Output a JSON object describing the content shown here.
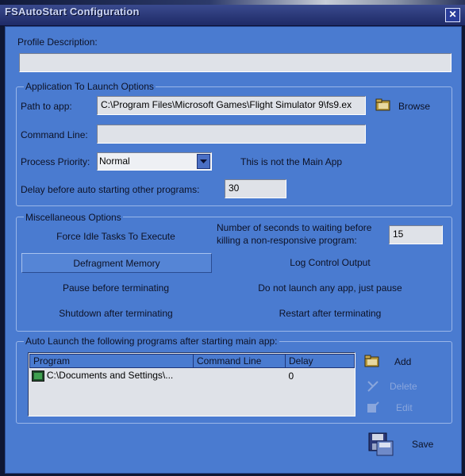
{
  "window": {
    "title": "FSAutoStart Configuration"
  },
  "profile": {
    "label": "Profile Description:",
    "value": ""
  },
  "app_options": {
    "group_title": "Application To Launch Options",
    "path_label": "Path to app:",
    "path_value": "C:\\Program Files\\Microsoft Games\\Flight Simulator 9\\fs9.ex",
    "browse_label": "Browse",
    "cmdline_label": "Command Line:",
    "cmdline_value": "",
    "priority_label": "Process Priority:",
    "priority_value": "Normal",
    "main_app_text": "This is not the Main App",
    "delay_label": "Delay before auto starting other programs:",
    "delay_value": "30"
  },
  "misc": {
    "group_title": "Miscellaneous Options",
    "force_idle": "Force Idle Tasks To Execute",
    "seconds_label_line1": "Number of seconds to waiting before",
    "seconds_label_line2": "killing a non-responsive program:",
    "seconds_value": "15",
    "defragment": "Defragment Memory",
    "log_control": "Log Control Output",
    "pause_before": "Pause before terminating",
    "do_not_launch": "Do not launch any app, just pause",
    "shutdown_after": "Shutdown after terminating",
    "restart_after": "Restart after terminating"
  },
  "autolaunch": {
    "group_title": "Auto Launch the following programs after starting main app:",
    "columns": [
      "Program",
      "Command Line",
      "Delay"
    ],
    "rows": [
      {
        "program": "C:\\Documents and Settings\\...",
        "command_line": "",
        "delay": "0"
      }
    ],
    "add_label": "Add",
    "delete_label": "Delete",
    "edit_label": "Edit"
  },
  "save_label": "Save",
  "icons": {
    "close": "close-icon",
    "browse": "folder-icon",
    "add": "folder-add-icon",
    "delete": "delete-icon",
    "edit": "edit-icon",
    "save": "save-floppy-icon",
    "row": "program-icon"
  },
  "colors": {
    "window_bg": "#4a7bd0",
    "title_bar": "#1e2a66",
    "field_bg": "#dfe2e8"
  }
}
